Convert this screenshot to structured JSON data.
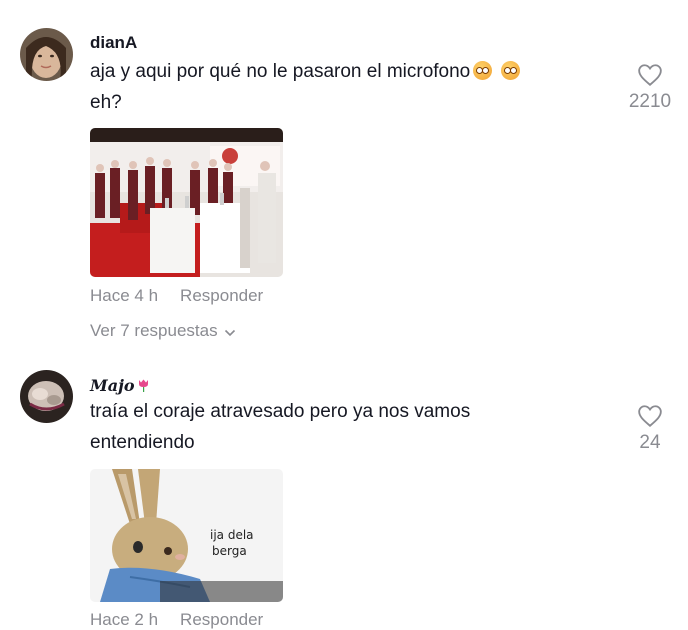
{
  "comments": [
    {
      "username": "dianA",
      "text": "aja y aqui por qué no le pasaron el microfono",
      "text_tail": "eh?",
      "emojis": [
        "flushed-face",
        "flushed-face"
      ],
      "likes": "2210",
      "time": "Hace 4 h",
      "reply_label": "Responder",
      "view_replies": "Ver 7 respuestas"
    },
    {
      "username": "Majo",
      "username_emoji": "tulip",
      "text": "traía el coraje atravesado pero ya nos vamos",
      "text_tail": "entendiendo",
      "likes": "24",
      "time": "Hace 2 h",
      "reply_label": "Responder",
      "sticker_caption_line1": "ija dela",
      "sticker_caption_line2": "berga"
    }
  ],
  "colors": {
    "text": "#161823",
    "muted": "#8a8b91",
    "background": "#ffffff"
  }
}
